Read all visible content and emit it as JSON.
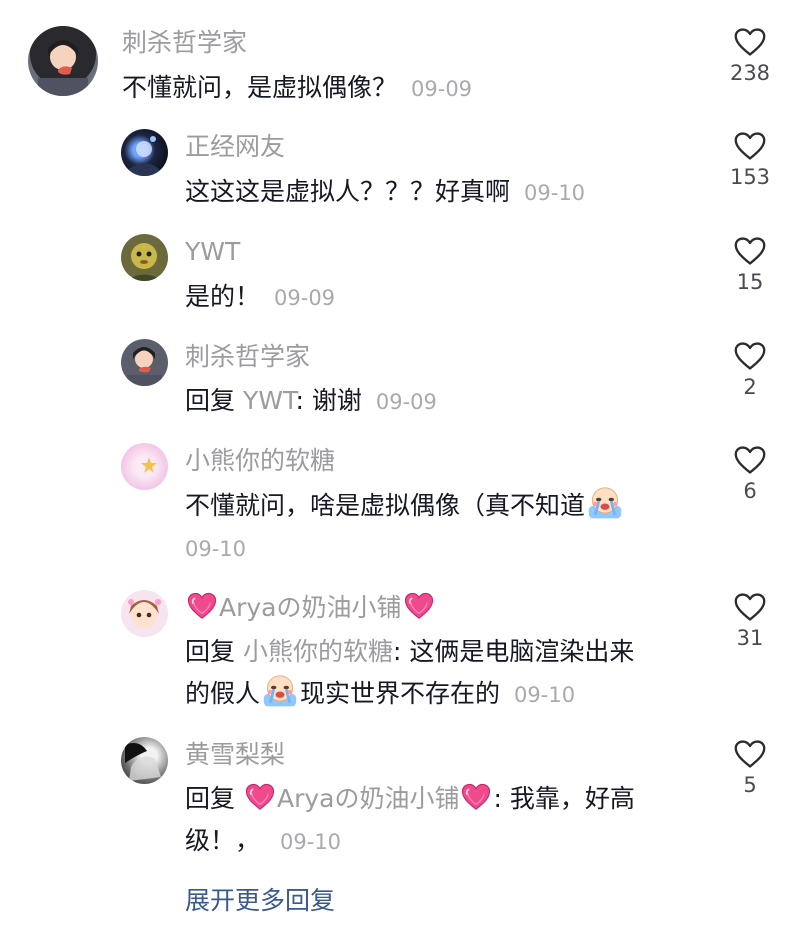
{
  "comment": {
    "author": "刺杀哲学家",
    "text": "不懂就问，是虚拟偶像？",
    "date": "09-09",
    "likes": "238"
  },
  "replies": [
    {
      "author": "正经网友",
      "text": "这这这是虚拟人？？？好真啊",
      "date": "09-10",
      "likes": "153"
    },
    {
      "author": "YWT",
      "text": "是的！",
      "date": "09-09",
      "likes": "15"
    },
    {
      "author": "刺杀哲学家",
      "reply_prefix": "回复",
      "mention": "YWT",
      "text": ": 谢谢",
      "date": "09-09",
      "likes": "2"
    },
    {
      "author": "小熊你的软糖",
      "text": "不懂就问，啥是虚拟偶像（真不知道",
      "date": "09-10",
      "likes": "6"
    },
    {
      "author": "Aryaの奶油小铺",
      "reply_prefix": "回复",
      "mention": "小熊你的软糖",
      "text_line1": ": 这俩是电脑渲染出来",
      "text_line2_a": "的假人",
      "text_line2_b": "现实世界不存在的",
      "date": "09-10",
      "likes": "31"
    },
    {
      "author": "黄雪梨梨",
      "reply_prefix": "回复",
      "mention": "Aryaの奶油小铺",
      "text_line1": ": 我靠，好高",
      "text_line2": "级！，",
      "date": "09-10",
      "likes": "5"
    }
  ],
  "expand_more": "展开更多回复",
  "colors": {
    "username": "#9b9ba0",
    "text": "#161823",
    "link": "#3a5a8c",
    "heart_emoji": "#f04a8c"
  },
  "icons": [
    "heart-outline-icon",
    "pink-heart-emoji",
    "crying-face-emoji"
  ]
}
